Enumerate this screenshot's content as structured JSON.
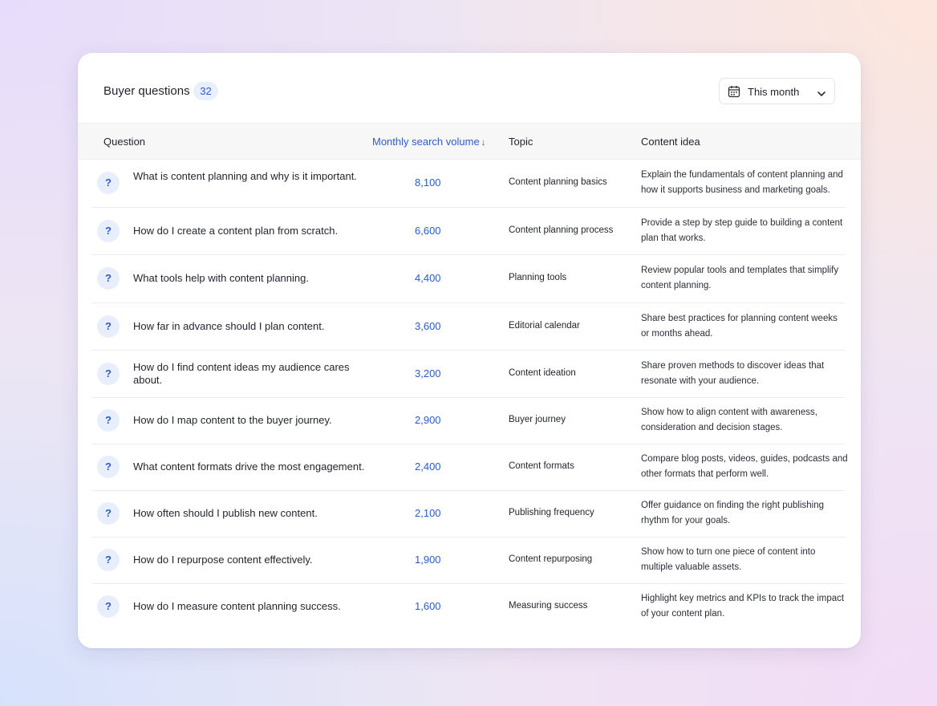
{
  "header": {
    "title": "Buyer questions",
    "count": "32",
    "date_filter": {
      "label": "This month",
      "icon": "calendar-icon",
      "chevron": "chevron-down-icon"
    }
  },
  "columns": {
    "question": "Question",
    "volume": "Monthly search volume",
    "volume_sort_indicator": "↓",
    "topic": "Topic",
    "idea": "Content idea"
  },
  "colors": {
    "accent": "#2b5cc7",
    "badge_bg": "#e8f0fd",
    "header_bg": "#f7f7f8"
  },
  "rows": [
    {
      "icon": "?",
      "question": "What is content planning and why is it important.",
      "volume": "8,100",
      "topic": "Content planning basics",
      "idea": "Explain the fundamentals of content planning and how it supports business and marketing goals."
    },
    {
      "icon": "?",
      "question": "How do I create a content plan from scratch.",
      "volume": "6,600",
      "topic": "Content planning process",
      "idea": "Provide a step by step guide to building a content plan that works."
    },
    {
      "icon": "?",
      "question": "What tools help with content planning.",
      "volume": "4,400",
      "topic": "Planning tools",
      "idea": "Review popular tools and templates that simplify content planning."
    },
    {
      "icon": "?",
      "question": "How far in advance should I plan content.",
      "volume": "3,600",
      "topic": "Editorial calendar",
      "idea": "Share best practices for planning content weeks or months ahead."
    },
    {
      "icon": "?",
      "question": "How do I find content ideas my audience cares about.",
      "volume": "3,200",
      "topic": "Content ideation",
      "idea": "Share proven methods to discover ideas that resonate with your audience."
    },
    {
      "icon": "?",
      "question": "How do I map content to the buyer journey.",
      "volume": "2,900",
      "topic": "Buyer journey",
      "idea": "Show how to align content with awareness, consideration and decision stages."
    },
    {
      "icon": "?",
      "question": "What content formats drive the most engagement.",
      "volume": "2,400",
      "topic": "Content formats",
      "idea": "Compare blog posts, videos, guides, podcasts and other formats that perform well."
    },
    {
      "icon": "?",
      "question": "How often should I publish new content.",
      "volume": "2,100",
      "topic": "Publishing frequency",
      "idea": "Offer guidance on finding the right publishing rhythm for your goals."
    },
    {
      "icon": "?",
      "question": "How do I repurpose content effectively.",
      "volume": "1,900",
      "topic": "Content repurposing",
      "idea": "Show how to turn one piece of content into multiple valuable assets."
    },
    {
      "icon": "?",
      "question": "How do I measure content planning success.",
      "volume": "1,600",
      "topic": "Measuring success",
      "idea": "Highlight key metrics and KPIs to track the impact of your content plan."
    }
  ]
}
